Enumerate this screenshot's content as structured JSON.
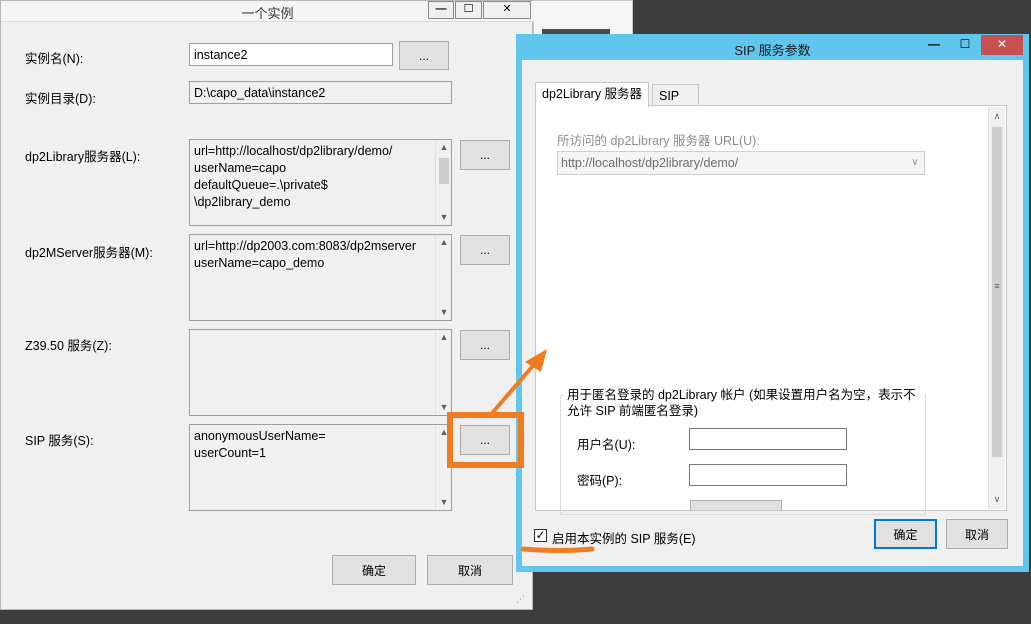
{
  "main_window": {
    "title": "一个实例",
    "title_buttons": [
      "—",
      "☐",
      "✕"
    ],
    "fields": {
      "instance_name_label": "实例名(N):",
      "instance_name_value": "instance2",
      "instance_dir_label": "实例目录(D):",
      "instance_dir_value": "D:\\capo_data\\instance2",
      "dp2library_label": "dp2Library服务器(L):",
      "dp2library_value": "url=http://localhost/dp2library/demo/\nuserName=capo\ndefaultQueue=.\\private$\n\\dp2library_demo",
      "dp2mserver_label": "dp2MServer服务器(M):",
      "dp2mserver_value": "url=http://dp2003.com:8083/dp2mserver\nuserName=capo_demo",
      "z3950_label": "Z39.50 服务(Z):",
      "z3950_value": "",
      "sip_label": "SIP 服务(S):",
      "sip_value": "anonymousUserName=\nuserCount=1"
    },
    "browse_button": "...",
    "ok_button": "确定",
    "cancel_button": "取消"
  },
  "sip_dialog": {
    "title": "SIP 服务参数",
    "title_buttons": [
      "—",
      "☐",
      "✕"
    ],
    "tabs": [
      {
        "label": "dp2Library 服务器",
        "active": true
      },
      {
        "label": "SIP",
        "active": false
      }
    ],
    "url_label": "所访问的 dp2Library 服务器 URL(U):",
    "url_value": "http://localhost/dp2library/demo/",
    "anon_group_label": "用于匿名登录的 dp2Library 帐户 (如果设置用户名为空，表示不允许 SIP 前端匿名登录)",
    "username_label": "用户名(U):",
    "username_value": "",
    "password_label": "密码(P):",
    "password_value": "",
    "enable_checkbox_label": "启用本实例的 SIP 服务(E)",
    "enable_checked": true,
    "ok_button": "确定",
    "cancel_button": "取消"
  },
  "annotation": {
    "highlight_color": "#f07c22"
  }
}
